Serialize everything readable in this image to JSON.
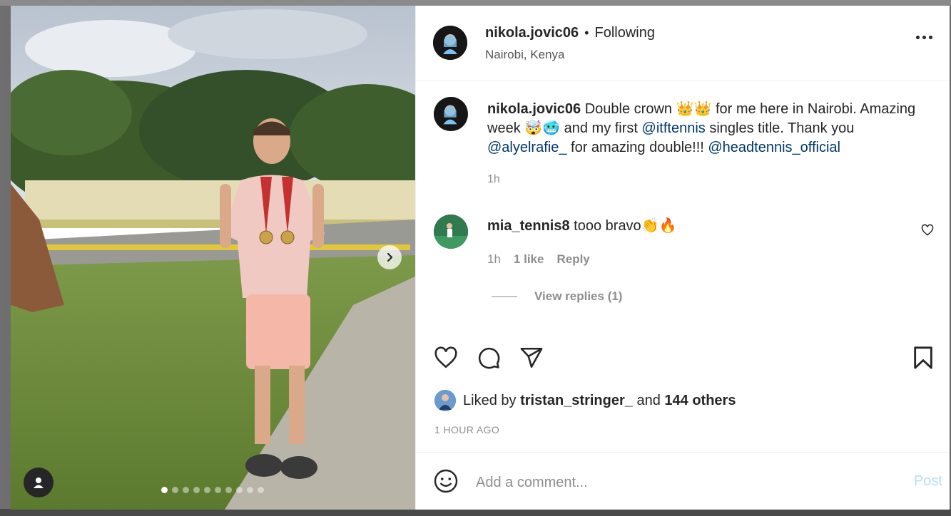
{
  "post": {
    "username": "nikola.jovic06",
    "follow_status": "Following",
    "separator": "•",
    "location": "Nairobi, Kenya",
    "image_pagination": {
      "current": 1,
      "total": 10
    }
  },
  "caption": {
    "username": "nikola.jovic06",
    "text_1": "Double crown 👑👑 for me here in Nairobi. Amazing week 🤯🥶 and my first ",
    "mention_1": "@itftennis",
    "text_2": " singles title. Thank you ",
    "mention_2": "@alyelrafie_",
    "text_3": " for amazing double!!! ",
    "mention_3": "@headtennis_official",
    "time": "1h"
  },
  "comment": {
    "username": "mia_tennis8",
    "text": "tooo bravo👏🔥",
    "time": "1h",
    "likes": "1 like",
    "reply_label": "Reply",
    "view_replies": "View replies (1)"
  },
  "likes": {
    "prefix": "Liked by",
    "user": "tristan_stringer_",
    "joiner": "and",
    "others": "144 others",
    "time_ago": "1 HOUR AGO"
  },
  "add_comment": {
    "placeholder": "Add a comment...",
    "post_label": "Post"
  },
  "colors": {
    "link": "#00376b",
    "post_disabled": "#b2dffc",
    "muted": "#8e8e8e"
  }
}
